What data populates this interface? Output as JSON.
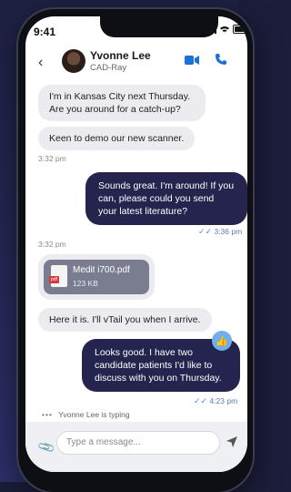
{
  "status": {
    "time": "9:41"
  },
  "header": {
    "name": "Yvonne Lee",
    "subtitle": "CAD-Ray",
    "back_icon": "chevron-left-icon",
    "video_icon": "video-icon",
    "call_icon": "phone-icon",
    "accent": "#1e6fd6"
  },
  "messages": [
    {
      "type": "in",
      "text": "I'm in Kansas City next Thursday. Are you around for a catch-up?"
    },
    {
      "type": "in",
      "text": "Keen to demo our new scanner."
    },
    {
      "type": "time",
      "text": "3:32 pm"
    },
    {
      "type": "out",
      "text": "Sounds great. I'm around! If you can, please could you send your latest literature?"
    },
    {
      "type": "read_time",
      "text": "3:36 pm"
    },
    {
      "type": "time",
      "text": "3:32 pm"
    },
    {
      "type": "file",
      "name": "Medit i700.pdf",
      "size": "123 KB",
      "badge": "pdf"
    },
    {
      "type": "in",
      "text": "Here it is. I'll vTail you when I arrive."
    },
    {
      "type": "out",
      "text": "Looks good. I have two candidate patients I'd like to discuss with you on Thursday."
    },
    {
      "type": "read_time",
      "text": "4:23 pm"
    }
  ],
  "typing": {
    "text": "Yvonne Lee is typing"
  },
  "composer": {
    "placeholder": "Type a message..."
  },
  "colors": {
    "outgoing": "#24244e",
    "incoming": "#ececf0",
    "like": "#6fb0ea"
  }
}
